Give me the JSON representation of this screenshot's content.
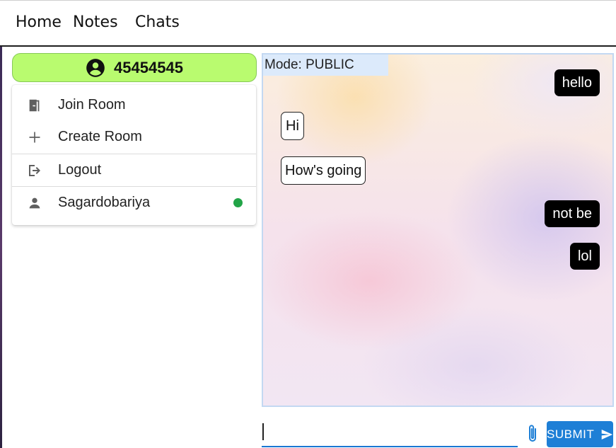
{
  "nav": {
    "home": "Home",
    "notes": "Notes",
    "chats": "Chats"
  },
  "user": {
    "id": "45454545",
    "icon": "account-circle-icon"
  },
  "menu": {
    "join_room": "Join Room",
    "create_room": "Create Room",
    "logout": "Logout",
    "username": "Sagardobariya",
    "status": "online"
  },
  "chat": {
    "mode_label": "Mode: PUBLIC",
    "messages": [
      {
        "text": "hello",
        "direction": "outgoing"
      },
      {
        "text": "Hi",
        "direction": "incoming"
      },
      {
        "text": "How's going",
        "direction": "incoming"
      },
      {
        "text": "not be",
        "direction": "outgoing"
      },
      {
        "text": "lol",
        "direction": "outgoing"
      }
    ]
  },
  "composer": {
    "value": "",
    "submit_label": "SUBMIT"
  },
  "colors": {
    "user_pill": "#b9fb6f",
    "online": "#22a447",
    "primary": "#1e7fd6",
    "outgoing_bubble": "#000000"
  }
}
